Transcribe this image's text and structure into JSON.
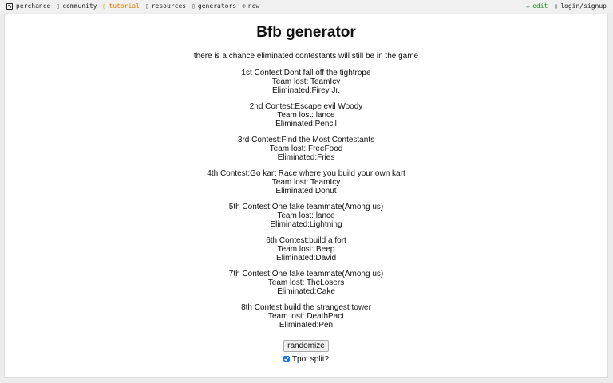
{
  "nav": {
    "site": "perchance",
    "items": [
      {
        "label": "community",
        "icon": "community-icon"
      },
      {
        "label": "tutorial",
        "icon": "tutorial-icon"
      },
      {
        "label": "resources",
        "icon": "resources-icon"
      },
      {
        "label": "generators",
        "icon": "generators-icon"
      },
      {
        "label": "new",
        "icon": "plus-icon"
      }
    ],
    "edit": "edit",
    "login": "login/signup",
    "accent": "#e07b00"
  },
  "page": {
    "title": "Bfb generator",
    "note": "there is a chance eliminated contestants will still be in the game",
    "contests": [
      {
        "contest": "1st Contest:Dont fall off the tightrope",
        "team": "Team lost: TeamIcy",
        "eliminated": "Eliminated:Firey Jr."
      },
      {
        "contest": "2nd Contest:Escape evil Woody",
        "team": "Team lost: lance",
        "eliminated": "Eliminated:Pencil"
      },
      {
        "contest": "3rd Contest:Find the Most Contestants",
        "team": "Team lost: FreeFood",
        "eliminated": "Eliminated:Fries"
      },
      {
        "contest": "4th Contest:Go kart Race where you build your own kart",
        "team": "Team lost: TeamIcy",
        "eliminated": "Eliminated:Donut"
      },
      {
        "contest": "5th Contest:One fake teammate(Among us)",
        "team": "Team lost: lance",
        "eliminated": "Eliminated:Lightning"
      },
      {
        "contest": "6th Contest:build a fort",
        "team": "Team lost: Beep",
        "eliminated": "Eliminated:David"
      },
      {
        "contest": "7th Contest:One fake teammate(Among us)",
        "team": "Team lost: TheLosers",
        "eliminated": "Eliminated:Cake"
      },
      {
        "contest": "8th Contest:build the strangest tower",
        "team": "Team lost: DeathPact",
        "eliminated": "Eliminated:Pen"
      }
    ],
    "randomize": "randomize",
    "tpot_split": "Tpot split?",
    "tpot_checked": true
  }
}
